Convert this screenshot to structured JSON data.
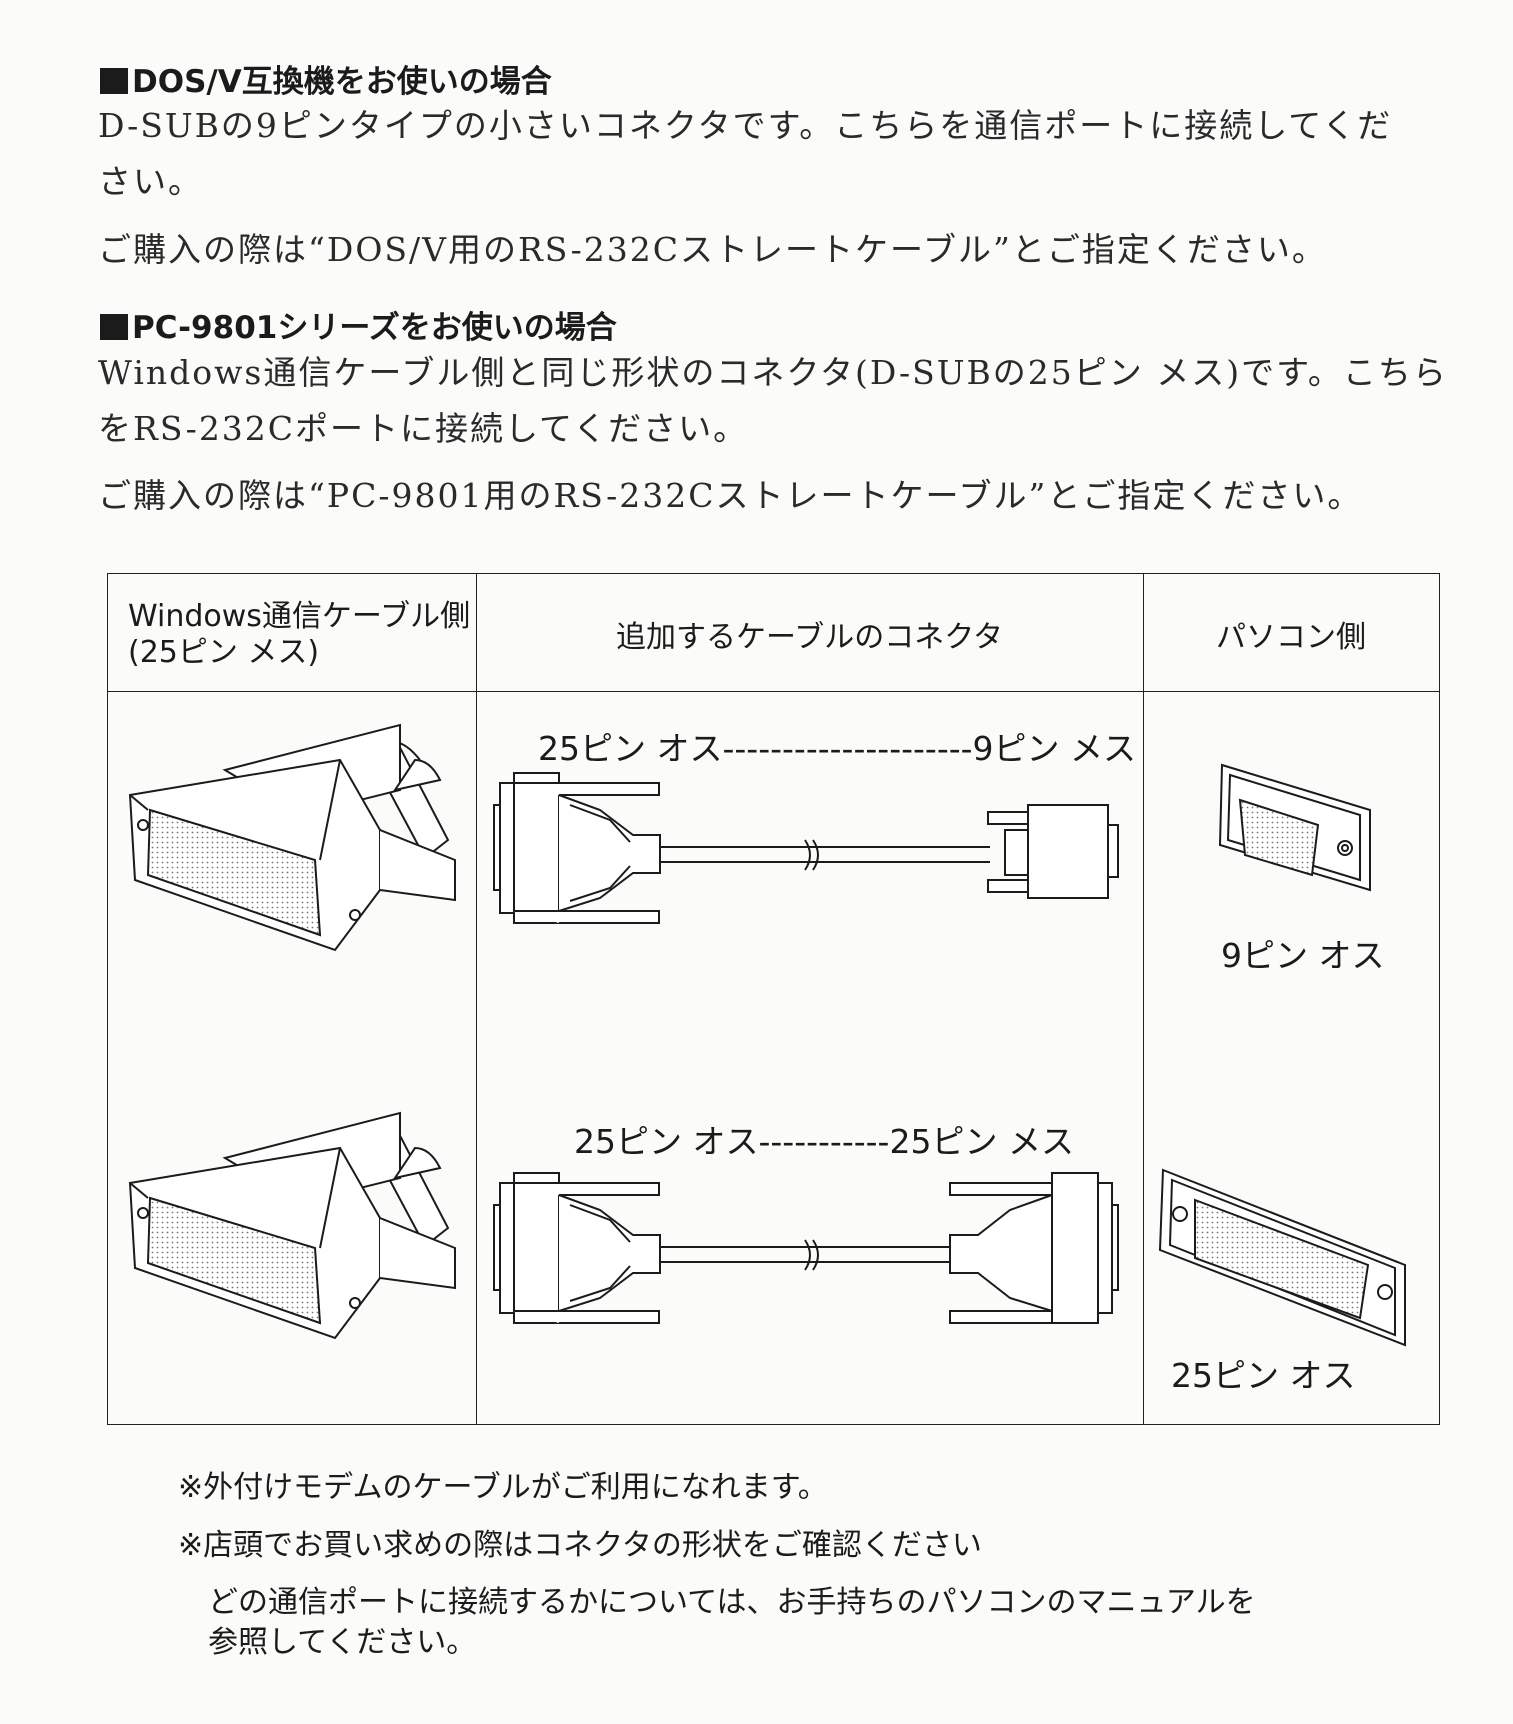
{
  "section_dosv": {
    "heading": "DOS/V互換機をお使いの場合",
    "para1_line1": "D-SUBの9ピンタイプの小さいコネクタです。こちらを通信ポートに接続してくだ",
    "para1_line2": "さい。",
    "para2": "ご購入の際は“DOS/V用のRS-232Cストレートケーブル”とご指定ください。"
  },
  "section_pc98": {
    "heading": "PC-9801シリーズをお使いの場合",
    "para1_line1": "Windows通信ケーブル側と同じ形状のコネクタ(D-SUBの25ピン メス)です。こちら",
    "para1_line2": "をRS-232Cポートに接続してください。",
    "para2": "ご購入の際は“PC-9801用のRS-232Cストレートケーブル”とご指定ください。"
  },
  "table": {
    "col1_header_line1": "Windows通信ケーブル側",
    "col1_header_line2": "(25ピン メス)",
    "col2_header": "追加するケーブルのコネクタ",
    "col3_header": "パソコン側",
    "row1_cable_label": "25ピン オス---------------------9ピン メス",
    "row1_pc_label": "9ピン オス",
    "row2_cable_label": "25ピン オス-----------25ピン メス",
    "row2_pc_label": "25ピン オス"
  },
  "notes": {
    "note1": "※外付けモデムのケーブルがご利用になれます。",
    "note2": "※店頭でお買い求めの際はコネクタの形状をご確認ください",
    "note3_line1": "どの通信ポートに接続するかについては、お手持ちのパソコンのマニュアルを",
    "note3_line2": "参照してください。"
  }
}
